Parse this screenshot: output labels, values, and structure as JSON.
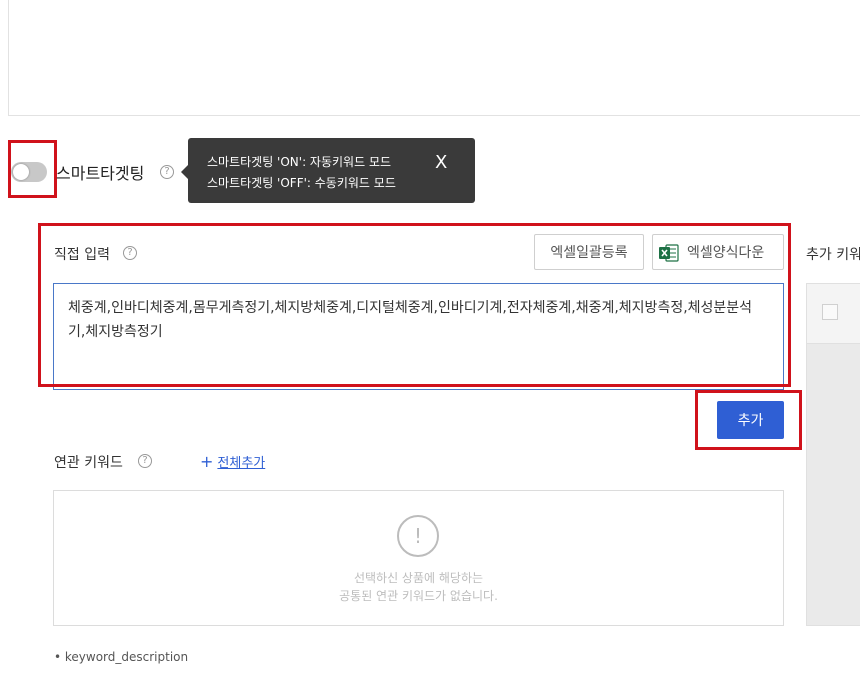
{
  "smart_targeting": {
    "label": "스마트타겟팅",
    "help": "?",
    "state": "off"
  },
  "tooltip": {
    "line_on": "스마트타겟팅 'ON': 자동키워드 모드",
    "line_off": "스마트타겟팅 'OFF': 수동키워드 모드",
    "close": "X"
  },
  "direct_input": {
    "label": "직접 입력",
    "help": "?",
    "bulk_upload_button": "엑셀일괄등록",
    "form_download_button": "엑셀양식다운",
    "textarea_value": "체중계,인바디체중계,몸무게측정기,체지방체중계,디지털체중계,인바디기계,전자체중계,채중계,체지방측정,체성분분석기,체지방측정기"
  },
  "add_button": "추가",
  "added_keywords": {
    "label": "추가 키워"
  },
  "related_keywords": {
    "label": "연관 키워드",
    "help": "?",
    "add_all_icon": "+",
    "add_all_label": "전체추가",
    "empty_icon": "!",
    "empty_message_line1": "선택하신 상품에 해당하는",
    "empty_message_line2": "공통된 연관 키워드가 없습니다."
  },
  "footer": {
    "description": "• keyword_description"
  },
  "colors": {
    "accent": "#2f5fd4",
    "highlight": "#d0121b",
    "tooltip_bg": "#3a3a3a",
    "excel_green": "#1e7145"
  }
}
